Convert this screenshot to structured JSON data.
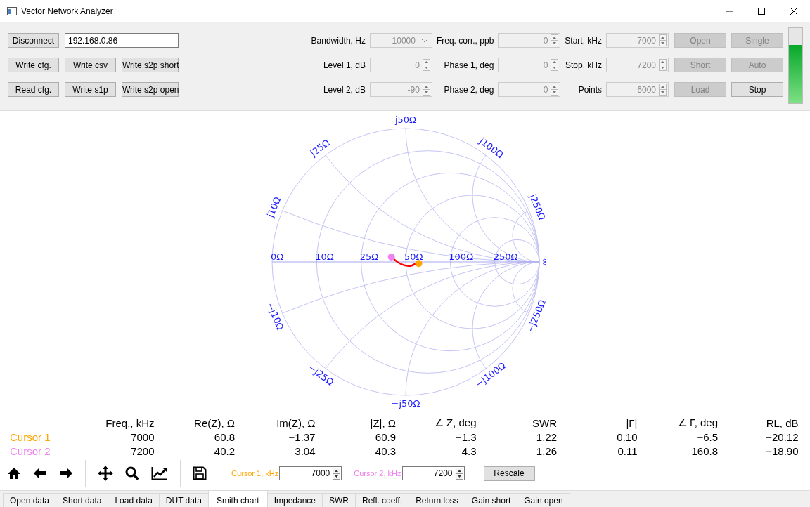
{
  "window": {
    "title": "Vector Network Analyzer"
  },
  "connection": {
    "button": "Disconnect",
    "address": "192.168.0.86"
  },
  "file_buttons": [
    "Write cfg.",
    "Write csv",
    "Write s2p short",
    "Read cfg.",
    "Write s1p",
    "Write s2p open"
  ],
  "settings": [
    {
      "label": "Bandwidth, Hz",
      "value": "10000",
      "kind": "dropdown",
      "disabled": true
    },
    {
      "label": "Freq. corr., ppb",
      "value": "0",
      "kind": "spin",
      "disabled": true
    },
    {
      "label": "Start, kHz",
      "value": "7000",
      "kind": "spin",
      "disabled": true
    },
    {
      "label": "Level 1, dB",
      "value": "0",
      "kind": "spin",
      "disabled": true
    },
    {
      "label": "Phase 1, deg",
      "value": "0",
      "kind": "spin",
      "disabled": true
    },
    {
      "label": "Stop, kHz",
      "value": "7200",
      "kind": "spin",
      "disabled": true
    },
    {
      "label": "Level 2, dB",
      "value": "-90",
      "kind": "spin",
      "disabled": true
    },
    {
      "label": "Phase 2, deg",
      "value": "0",
      "kind": "spin",
      "disabled": true
    },
    {
      "label": "Points",
      "value": "6000",
      "kind": "spin",
      "disabled": true
    }
  ],
  "actions": [
    {
      "label": "Open",
      "disabled": true
    },
    {
      "label": "Single",
      "disabled": true
    },
    {
      "label": "Short",
      "disabled": true
    },
    {
      "label": "Auto",
      "disabled": true
    },
    {
      "label": "Load",
      "disabled": true
    },
    {
      "label": "Stop",
      "disabled": false
    }
  ],
  "level_meter": {
    "level": 0.78
  },
  "smith_chart": {
    "resistance_labels": [
      "0Ω",
      "10Ω",
      "25Ω",
      "50Ω",
      "100Ω",
      "250Ω"
    ],
    "upper_reactance_labels": [
      "j10Ω",
      "j25Ω",
      "j50Ω",
      "j100Ω",
      "j250Ω"
    ],
    "lower_reactance_labels": [
      "−j10Ω",
      "−j25Ω",
      "−j50Ω",
      "−j100Ω",
      "−j250Ω"
    ],
    "infinity_label": "∞"
  },
  "cursor_table": {
    "columns": [
      "Freq., kHz",
      "Re(Z), Ω",
      "Im(Z), Ω",
      "|Z|, Ω",
      "∠ Z, deg",
      "SWR",
      "|Γ|",
      "∠ Γ, deg",
      "RL, dB"
    ],
    "rows": [
      {
        "name": "Cursor 1",
        "color": "#ffa500",
        "values": [
          "7000",
          "60.8",
          "−1.37",
          "60.9",
          "−1.3",
          "1.22",
          "0.10",
          "−6.5",
          "−20.12"
        ]
      },
      {
        "name": "Cursor 2",
        "color": "#ee82ee",
        "values": [
          "7200",
          "40.2",
          "3.04",
          "40.3",
          "4.3",
          "1.26",
          "0.11",
          "160.8",
          "−18.90"
        ]
      }
    ]
  },
  "cursor_fields": [
    {
      "label": "Cursor 1, kHz",
      "value": "7000",
      "color": "#ffa500"
    },
    {
      "label": "Cursor 2, kHz",
      "value": "7200",
      "color": "#ee82ee"
    }
  ],
  "rescale_button": "Rescale",
  "tabs": [
    {
      "label": "Open data",
      "selected": false
    },
    {
      "label": "Short data",
      "selected": false
    },
    {
      "label": "Load data",
      "selected": false
    },
    {
      "label": "DUT data",
      "selected": false
    },
    {
      "label": "Smith chart",
      "selected": true
    },
    {
      "label": "Impedance",
      "selected": false
    },
    {
      "label": "SWR",
      "selected": false
    },
    {
      "label": "Refl. coeff.",
      "selected": false
    },
    {
      "label": "Return loss",
      "selected": false
    },
    {
      "label": "Gain short",
      "selected": false
    },
    {
      "label": "Gain open",
      "selected": false
    }
  ]
}
